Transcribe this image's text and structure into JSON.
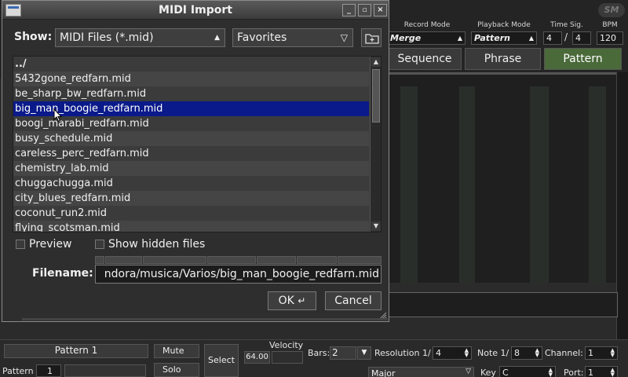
{
  "dialog": {
    "title": "MIDI Import",
    "show_label": "Show:",
    "filter": "MIDI Files (*.mid)",
    "location": "Favorites",
    "files": [
      "../",
      "5432gone_redfarn.mid",
      "be_sharp_bw_redfarn.mid",
      "big_man_boogie_redfarn.mid",
      "boogi_marabi_redfarn.mid",
      "busy_schedule.mid",
      "careless_perc_redfarn.mid",
      "chemistry_lab.mid",
      "chuggachugga.mid",
      "city_blues_redfarn.mid",
      "coconut_run2.mid",
      "flying_scotsman.mid"
    ],
    "selected_index": 3,
    "preview_label": "Preview",
    "hidden_label": "Show hidden files",
    "filename_label": "Filename:",
    "filename_value": "ndora/musica/Varios/big_man_boogie_redfarn.mid",
    "ok_label": "OK",
    "cancel_label": "Cancel"
  },
  "app": {
    "logo": "SM",
    "record_mode_label": "Record Mode",
    "record_mode": "Merge",
    "playback_mode_label": "Playback Mode",
    "playback_mode": "Pattern",
    "time_sig_label": "Time Sig.",
    "time_sig_num": "4",
    "time_sig_den": "4",
    "bpm_label": "BPM",
    "bpm": "120",
    "tabs": [
      "Sequence",
      "Phrase",
      "Pattern"
    ],
    "active_tab": 2
  },
  "bottom": {
    "pattern_name": "Pattern 1",
    "mute": "Mute",
    "solo": "Solo",
    "select": "Select",
    "velocity_label": "Velocity",
    "velocity": "64.00",
    "bars_label": "Bars:",
    "bars": "2",
    "resolution_label": "Resolution 1/",
    "resolution": "4",
    "note_label": "Note 1/",
    "note": "8",
    "channel_label": "Channel:",
    "channel": "1",
    "pattern_label": "Pattern",
    "pattern_num": "1",
    "scale": "Major",
    "key_label": "Key",
    "key": "C",
    "port_label": "Port:",
    "port": "1"
  },
  "colors": {
    "selection": "#0a1a8a",
    "active_tab": "#4a6a3a"
  }
}
